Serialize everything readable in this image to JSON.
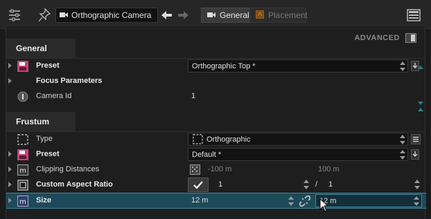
{
  "toolbar": {
    "object_name": "Orthographic Camera",
    "tabs": [
      {
        "label": "General",
        "active": true
      },
      {
        "label": "Placement",
        "active": false
      }
    ]
  },
  "advanced": {
    "label": "ADVANCED"
  },
  "sections": {
    "general": {
      "title": "General",
      "preset": {
        "label": "Preset",
        "value": "Orthographic Top *"
      },
      "focus": {
        "label": "Focus Parameters"
      },
      "camera_id": {
        "label": "Camera Id",
        "value": "1"
      }
    },
    "frustum": {
      "title": "Frustum",
      "type": {
        "label": "Type",
        "value": "Orthographic"
      },
      "preset": {
        "label": "Preset",
        "value": "Default *"
      },
      "clipping": {
        "label": "Clipping Distances",
        "near": "-100 m",
        "far": "100 m"
      },
      "aspect": {
        "label": "Custom Aspect Ratio",
        "num": "1",
        "sep": "/",
        "den": "1"
      },
      "size": {
        "label": "Size",
        "width": "12 m",
        "height": "12 m"
      }
    }
  },
  "colors": {
    "accent": "#2a7f8f",
    "selection": "#1d4a5a",
    "preset_icon": "#c8437a"
  }
}
